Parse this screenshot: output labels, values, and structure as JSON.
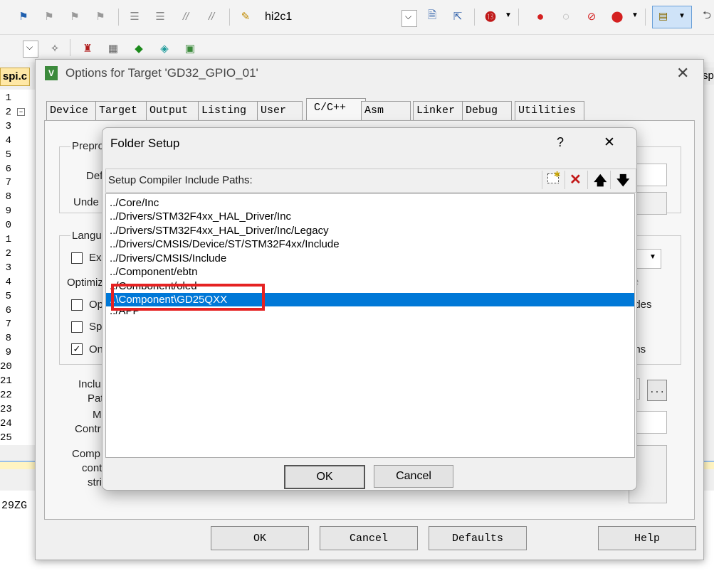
{
  "toolbar1": {
    "combo_value": "hi2c1"
  },
  "editor": {
    "tab_left": "spi.c",
    "tab_right": "sp",
    "line_numbers": [
      "1",
      "2",
      "3",
      "4",
      "5",
      "6",
      "7",
      "8",
      "9",
      "0",
      "1",
      "2",
      "3",
      "4",
      "5",
      "6",
      "7",
      "8",
      "9",
      "20",
      "21",
      "22",
      "23",
      "24",
      "25"
    ],
    "output_text": "29ZG"
  },
  "options": {
    "title": "Options for Target 'GD32_GPIO_01'",
    "tabs": [
      "Device",
      "Target",
      "Output",
      "Listing",
      "User",
      "C/C++",
      "Asm",
      "Linker",
      "Debug",
      "Utilities"
    ],
    "active_tab": "C/C++",
    "labels": {
      "preprocessor": "Prepro",
      "define": "Def",
      "undefine": "Unde",
      "language": "Langu",
      "ex": "Ex",
      "optimization": "Optimiz",
      "op": "Op",
      "sp": "Sp",
      "on": "On",
      "include_paths_1": "Inclu",
      "include_paths_2": "Pat",
      "misc_1": "M",
      "misc_2": "Contr",
      "compiler_1": "Comp",
      "compiler_2": "cont",
      "compiler_3": "stri",
      "right_e": "e",
      "right_udes": "udes",
      "right_ons": "ons",
      "right_l": "l",
      "browse": "..."
    },
    "buttons": {
      "ok": "OK",
      "cancel": "Cancel",
      "defaults": "Defaults",
      "help": "Help"
    }
  },
  "folder_setup": {
    "title": "Folder Setup",
    "help_glyph": "?",
    "close_glyph": "✕",
    "list_label": "Setup Compiler Include Paths:",
    "paths": [
      "../Core/Inc",
      "../Drivers/STM32F4xx_HAL_Driver/Inc",
      "../Drivers/STM32F4xx_HAL_Driver/Inc/Legacy",
      "../Drivers/CMSIS/Device/ST/STM32F4xx/Include",
      "../Drivers/CMSIS/Include",
      "../Component/ebtn",
      "../Component/oled",
      "..\\Component\\GD25QXX",
      "../APP"
    ],
    "selected_index": 7,
    "buttons": {
      "ok": "OK",
      "cancel": "Cancel"
    },
    "highlight_color": "#e52222",
    "selection_color": "#0078d7"
  }
}
